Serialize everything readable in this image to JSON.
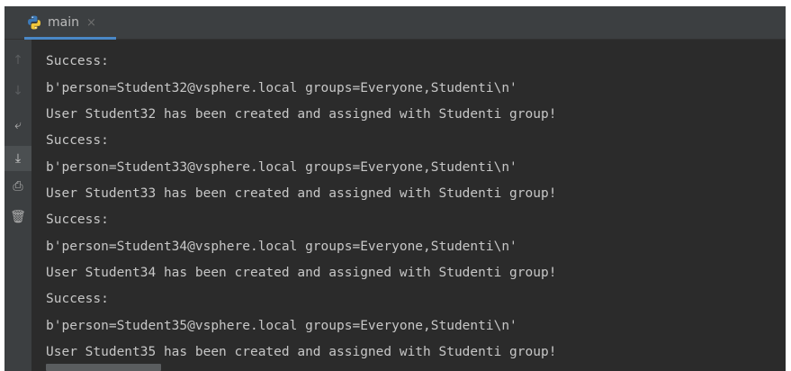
{
  "tab": {
    "label": "main",
    "close_glyph": "×",
    "icon": "python-icon"
  },
  "gutter": {
    "buttons": [
      {
        "name": "up-arrow-icon",
        "glyph": "↑"
      },
      {
        "name": "down-arrow-icon",
        "glyph": "↓"
      },
      {
        "name": "soft-wrap-icon",
        "glyph": "⤶"
      },
      {
        "name": "scroll-to-end-icon",
        "glyph": "⤓"
      },
      {
        "name": "print-icon",
        "glyph": "⎙"
      },
      {
        "name": "trash-icon",
        "glyph": "🗑"
      }
    ]
  },
  "console": {
    "lines": [
      "Success:",
      "b'person=Student32@vsphere.local groups=Everyone,Studenti\\n'",
      "User Student32 has been created and assigned with Studenti group!",
      "Success:",
      "b'person=Student33@vsphere.local groups=Everyone,Studenti\\n'",
      "User Student33 has been created and assigned with Studenti group!",
      "Success:",
      "b'person=Student34@vsphere.local groups=Everyone,Studenti\\n'",
      "User Student34 has been created and assigned with Studenti group!",
      "Success:",
      "b'person=Student35@vsphere.local groups=Everyone,Studenti\\n'",
      "User Student35 has been created and assigned with Studenti group!"
    ]
  },
  "colors": {
    "background": "#2b2b2b",
    "toolbar": "#3c3f41",
    "text": "#c7c7c7",
    "tab_underline": "#4a88c7"
  }
}
